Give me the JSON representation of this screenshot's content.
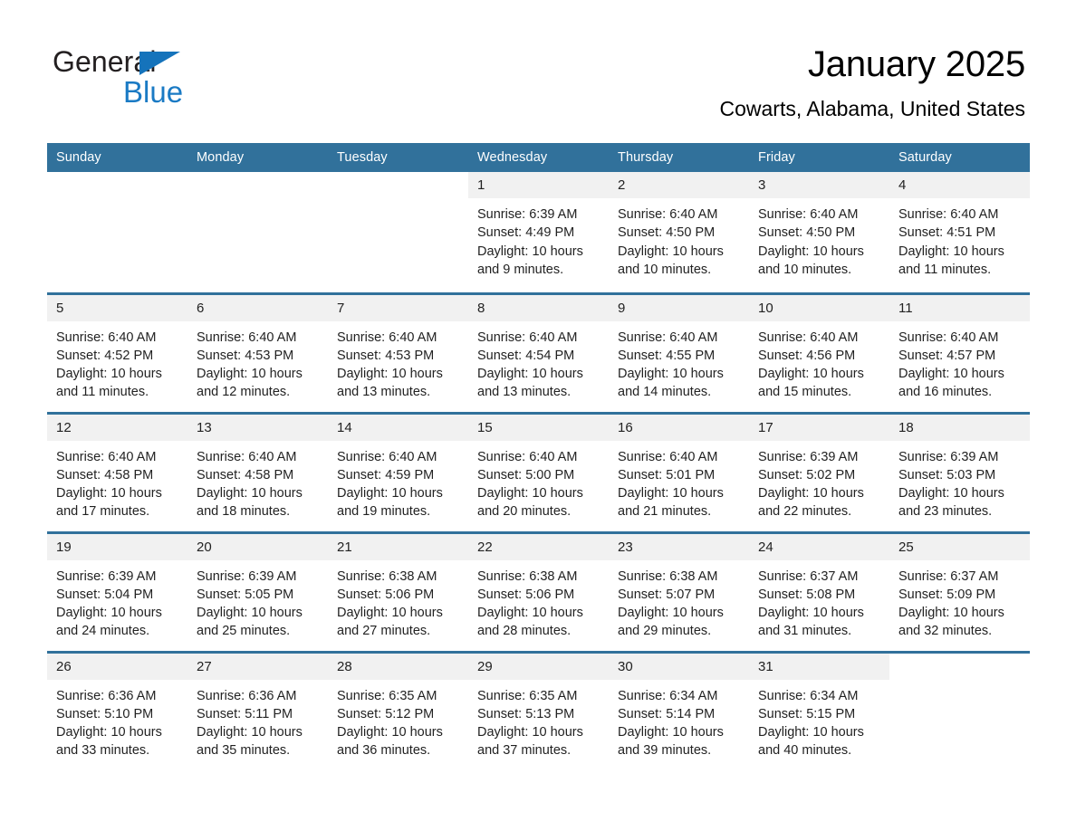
{
  "brand": {
    "word1": "General",
    "word2": "Blue",
    "triangle_color": "#1573bb",
    "text_color": "#231f20",
    "blue_text_color": "#1a7ac4"
  },
  "header": {
    "title": "January 2025",
    "subtitle": "Cowarts, Alabama, United States"
  },
  "theme": {
    "header_bg": "#31719b",
    "header_text": "#ffffff",
    "daynum_bg": "#f1f1f1",
    "cell_bg": "#ffffff",
    "row_divider": "#31719b"
  },
  "weekdays": [
    "Sunday",
    "Monday",
    "Tuesday",
    "Wednesday",
    "Thursday",
    "Friday",
    "Saturday"
  ],
  "weeks": [
    [
      {
        "day": "",
        "blank": true
      },
      {
        "day": "",
        "blank": true
      },
      {
        "day": "",
        "blank": true
      },
      {
        "day": "1",
        "sunrise": "Sunrise: 6:39 AM",
        "sunset": "Sunset: 4:49 PM",
        "daylight_line1": "Daylight: 10 hours",
        "daylight_line2": "and 9 minutes."
      },
      {
        "day": "2",
        "sunrise": "Sunrise: 6:40 AM",
        "sunset": "Sunset: 4:50 PM",
        "daylight_line1": "Daylight: 10 hours",
        "daylight_line2": "and 10 minutes."
      },
      {
        "day": "3",
        "sunrise": "Sunrise: 6:40 AM",
        "sunset": "Sunset: 4:50 PM",
        "daylight_line1": "Daylight: 10 hours",
        "daylight_line2": "and 10 minutes."
      },
      {
        "day": "4",
        "sunrise": "Sunrise: 6:40 AM",
        "sunset": "Sunset: 4:51 PM",
        "daylight_line1": "Daylight: 10 hours",
        "daylight_line2": "and 11 minutes."
      }
    ],
    [
      {
        "day": "5",
        "sunrise": "Sunrise: 6:40 AM",
        "sunset": "Sunset: 4:52 PM",
        "daylight_line1": "Daylight: 10 hours",
        "daylight_line2": "and 11 minutes."
      },
      {
        "day": "6",
        "sunrise": "Sunrise: 6:40 AM",
        "sunset": "Sunset: 4:53 PM",
        "daylight_line1": "Daylight: 10 hours",
        "daylight_line2": "and 12 minutes."
      },
      {
        "day": "7",
        "sunrise": "Sunrise: 6:40 AM",
        "sunset": "Sunset: 4:53 PM",
        "daylight_line1": "Daylight: 10 hours",
        "daylight_line2": "and 13 minutes."
      },
      {
        "day": "8",
        "sunrise": "Sunrise: 6:40 AM",
        "sunset": "Sunset: 4:54 PM",
        "daylight_line1": "Daylight: 10 hours",
        "daylight_line2": "and 13 minutes."
      },
      {
        "day": "9",
        "sunrise": "Sunrise: 6:40 AM",
        "sunset": "Sunset: 4:55 PM",
        "daylight_line1": "Daylight: 10 hours",
        "daylight_line2": "and 14 minutes."
      },
      {
        "day": "10",
        "sunrise": "Sunrise: 6:40 AM",
        "sunset": "Sunset: 4:56 PM",
        "daylight_line1": "Daylight: 10 hours",
        "daylight_line2": "and 15 minutes."
      },
      {
        "day": "11",
        "sunrise": "Sunrise: 6:40 AM",
        "sunset": "Sunset: 4:57 PM",
        "daylight_line1": "Daylight: 10 hours",
        "daylight_line2": "and 16 minutes."
      }
    ],
    [
      {
        "day": "12",
        "sunrise": "Sunrise: 6:40 AM",
        "sunset": "Sunset: 4:58 PM",
        "daylight_line1": "Daylight: 10 hours",
        "daylight_line2": "and 17 minutes."
      },
      {
        "day": "13",
        "sunrise": "Sunrise: 6:40 AM",
        "sunset": "Sunset: 4:58 PM",
        "daylight_line1": "Daylight: 10 hours",
        "daylight_line2": "and 18 minutes."
      },
      {
        "day": "14",
        "sunrise": "Sunrise: 6:40 AM",
        "sunset": "Sunset: 4:59 PM",
        "daylight_line1": "Daylight: 10 hours",
        "daylight_line2": "and 19 minutes."
      },
      {
        "day": "15",
        "sunrise": "Sunrise: 6:40 AM",
        "sunset": "Sunset: 5:00 PM",
        "daylight_line1": "Daylight: 10 hours",
        "daylight_line2": "and 20 minutes."
      },
      {
        "day": "16",
        "sunrise": "Sunrise: 6:40 AM",
        "sunset": "Sunset: 5:01 PM",
        "daylight_line1": "Daylight: 10 hours",
        "daylight_line2": "and 21 minutes."
      },
      {
        "day": "17",
        "sunrise": "Sunrise: 6:39 AM",
        "sunset": "Sunset: 5:02 PM",
        "daylight_line1": "Daylight: 10 hours",
        "daylight_line2": "and 22 minutes."
      },
      {
        "day": "18",
        "sunrise": "Sunrise: 6:39 AM",
        "sunset": "Sunset: 5:03 PM",
        "daylight_line1": "Daylight: 10 hours",
        "daylight_line2": "and 23 minutes."
      }
    ],
    [
      {
        "day": "19",
        "sunrise": "Sunrise: 6:39 AM",
        "sunset": "Sunset: 5:04 PM",
        "daylight_line1": "Daylight: 10 hours",
        "daylight_line2": "and 24 minutes."
      },
      {
        "day": "20",
        "sunrise": "Sunrise: 6:39 AM",
        "sunset": "Sunset: 5:05 PM",
        "daylight_line1": "Daylight: 10 hours",
        "daylight_line2": "and 25 minutes."
      },
      {
        "day": "21",
        "sunrise": "Sunrise: 6:38 AM",
        "sunset": "Sunset: 5:06 PM",
        "daylight_line1": "Daylight: 10 hours",
        "daylight_line2": "and 27 minutes."
      },
      {
        "day": "22",
        "sunrise": "Sunrise: 6:38 AM",
        "sunset": "Sunset: 5:06 PM",
        "daylight_line1": "Daylight: 10 hours",
        "daylight_line2": "and 28 minutes."
      },
      {
        "day": "23",
        "sunrise": "Sunrise: 6:38 AM",
        "sunset": "Sunset: 5:07 PM",
        "daylight_line1": "Daylight: 10 hours",
        "daylight_line2": "and 29 minutes."
      },
      {
        "day": "24",
        "sunrise": "Sunrise: 6:37 AM",
        "sunset": "Sunset: 5:08 PM",
        "daylight_line1": "Daylight: 10 hours",
        "daylight_line2": "and 31 minutes."
      },
      {
        "day": "25",
        "sunrise": "Sunrise: 6:37 AM",
        "sunset": "Sunset: 5:09 PM",
        "daylight_line1": "Daylight: 10 hours",
        "daylight_line2": "and 32 minutes."
      }
    ],
    [
      {
        "day": "26",
        "sunrise": "Sunrise: 6:36 AM",
        "sunset": "Sunset: 5:10 PM",
        "daylight_line1": "Daylight: 10 hours",
        "daylight_line2": "and 33 minutes."
      },
      {
        "day": "27",
        "sunrise": "Sunrise: 6:36 AM",
        "sunset": "Sunset: 5:11 PM",
        "daylight_line1": "Daylight: 10 hours",
        "daylight_line2": "and 35 minutes."
      },
      {
        "day": "28",
        "sunrise": "Sunrise: 6:35 AM",
        "sunset": "Sunset: 5:12 PM",
        "daylight_line1": "Daylight: 10 hours",
        "daylight_line2": "and 36 minutes."
      },
      {
        "day": "29",
        "sunrise": "Sunrise: 6:35 AM",
        "sunset": "Sunset: 5:13 PM",
        "daylight_line1": "Daylight: 10 hours",
        "daylight_line2": "and 37 minutes."
      },
      {
        "day": "30",
        "sunrise": "Sunrise: 6:34 AM",
        "sunset": "Sunset: 5:14 PM",
        "daylight_line1": "Daylight: 10 hours",
        "daylight_line2": "and 39 minutes."
      },
      {
        "day": "31",
        "sunrise": "Sunrise: 6:34 AM",
        "sunset": "Sunset: 5:15 PM",
        "daylight_line1": "Daylight: 10 hours",
        "daylight_line2": "and 40 minutes."
      },
      {
        "day": "",
        "blank": true
      }
    ]
  ]
}
